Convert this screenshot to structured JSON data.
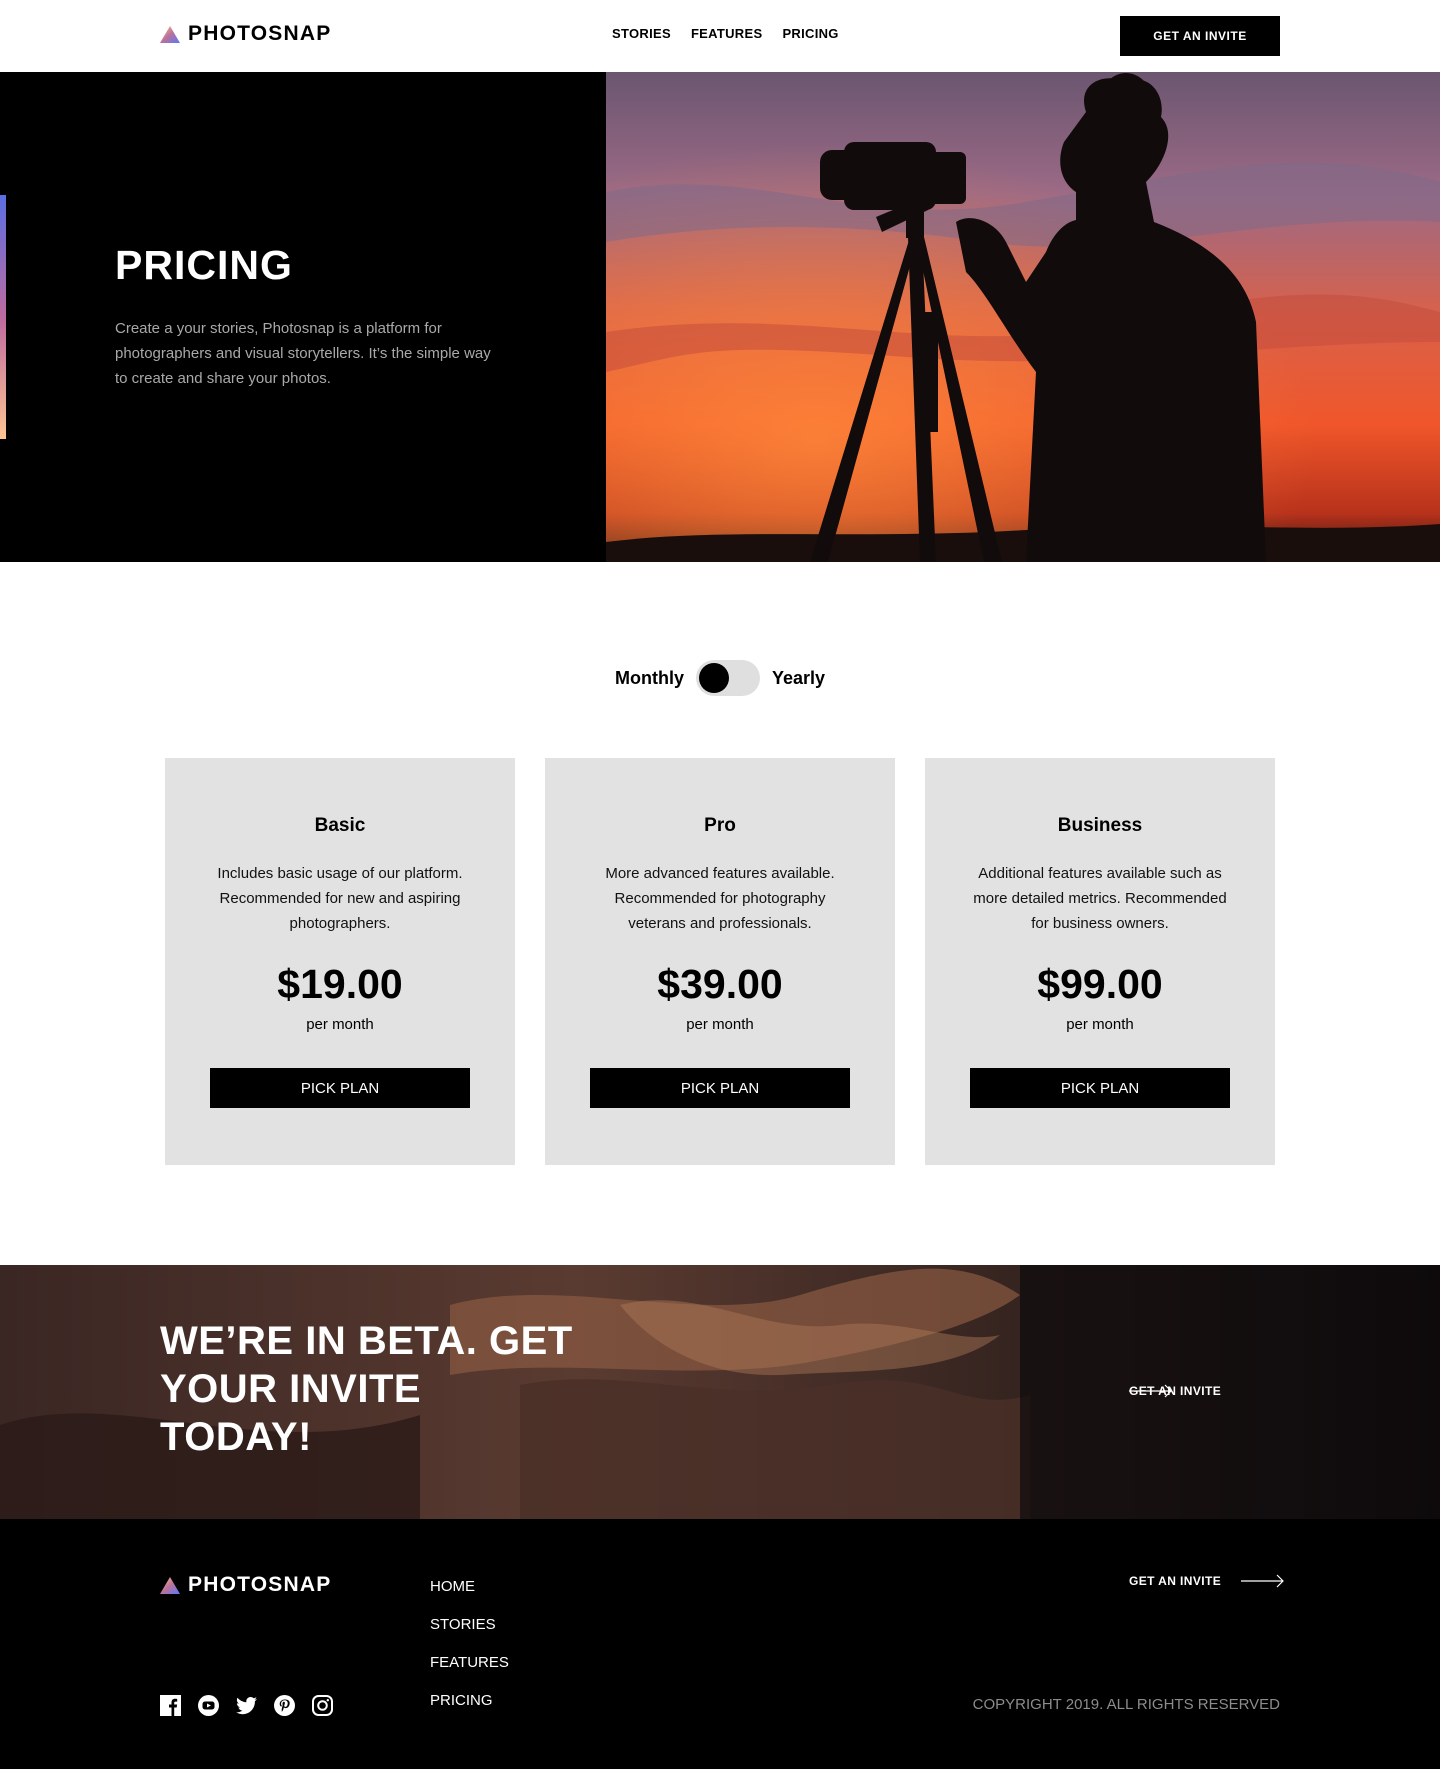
{
  "brand": {
    "name": "PHOTOSNAP"
  },
  "header": {
    "nav": [
      "STORIES",
      "FEATURES",
      "PRICING"
    ],
    "cta_label": "GET AN INVITE"
  },
  "hero": {
    "title": "PRICING",
    "text": "Create a your stories, Photosnap is a platform for photographers and visual storytellers. It’s the simple way to create and share your photos."
  },
  "billing_toggle": {
    "left_label": "Monthly",
    "right_label": "Yearly",
    "selected": "Monthly"
  },
  "plans": [
    {
      "name": "Basic",
      "description": "Includes basic usage of our platform. Recommended for new and aspiring photographers.",
      "price": "$19.00",
      "period": "per month",
      "button": "PICK PLAN"
    },
    {
      "name": "Pro",
      "description": "More advanced features available. Recommended for photography veterans and professionals.",
      "price": "$39.00",
      "period": "per month",
      "button": "PICK PLAN"
    },
    {
      "name": "Business",
      "description": "Additional features available such as more detailed metrics. Recommended for business owners.",
      "price": "$99.00",
      "period": "per month",
      "button": "PICK PLAN"
    }
  ],
  "beta": {
    "title": "WE’RE IN BETA. GET YOUR INVITE TODAY!",
    "link_label": "GET AN INVITE"
  },
  "footer": {
    "brand": "PHOTOSNAP",
    "nav": [
      "HOME",
      "STORIES",
      "FEATURES",
      "PRICING"
    ],
    "link_label": "GET AN INVITE",
    "copyright": "COPYRIGHT 2019. ALL RIGHTS RESERVED",
    "socials": [
      "facebook-icon",
      "youtube-icon",
      "twitter-icon",
      "pinterest-icon",
      "instagram-icon"
    ]
  },
  "colors": {
    "accent_gradient": [
      "#5a6fe3",
      "#bd6a9f",
      "#ffc593"
    ],
    "card_bg": "#e2e2e2",
    "primary": "#000000"
  }
}
